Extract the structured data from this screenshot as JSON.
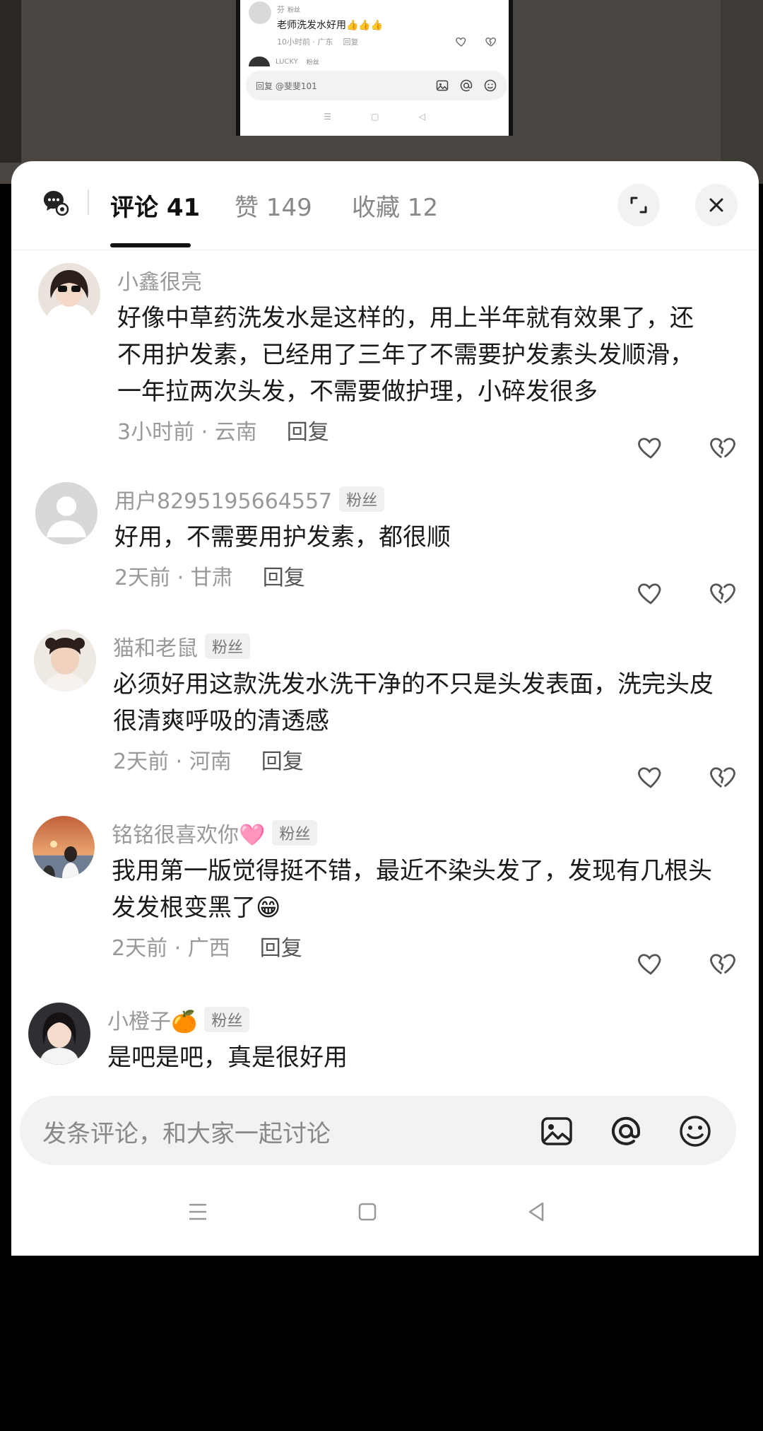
{
  "mini_screen": {
    "comment_name": "芬",
    "comment_tag": "粉丝",
    "comment_text": "老师洗发水好用👍👍👍",
    "comment_time": "10小时前 · 广东",
    "comment_reply": "回复",
    "next_name": "LUCKY",
    "next_tag": "粉丝",
    "input_placeholder": "回复 @斐斐101",
    "nav": [
      "☰",
      "▢",
      "◁"
    ]
  },
  "tabs": {
    "comments": "评论 41",
    "likes": "赞 149",
    "favorites": "收藏 12"
  },
  "comments": [
    {
      "name": "小鑫很亮",
      "badge": "",
      "text": "好像中草药洗发水是这样的，用上半年就有效果了，还不用护发素，已经用了三年了不需要护发素头发顺滑，一年拉两次头发，不需要做护理，小碎发很多",
      "time": "3小时前 · 云南",
      "reply": "回复"
    },
    {
      "name": "用户8295195664557",
      "badge": "粉丝",
      "text": "好用，不需要用护发素，都很顺",
      "time": "2天前 · 甘肃",
      "reply": "回复"
    },
    {
      "name": "猫和老鼠",
      "badge": "粉丝",
      "text": "必须好用这款洗发水洗干净的不只是头发表面，洗完头皮很清爽呼吸的清透感",
      "time": "2天前 · 河南",
      "reply": "回复"
    },
    {
      "name": "铭铭很喜欢你🩷",
      "badge": "粉丝",
      "text": "我用第一版觉得挺不错，最近不染头发了，发现有几根头发发根变黑了😁",
      "time": "2天前 · 广西",
      "reply": "回复"
    },
    {
      "name": "小橙子🍊",
      "badge": "粉丝",
      "text": "是吧是吧，真是很好用",
      "time": "",
      "reply": ""
    }
  ],
  "input": {
    "placeholder": "发条评论，和大家一起讨论"
  },
  "icons": {
    "share": "share-icon",
    "expand": "expand-icon",
    "close": "close-icon",
    "like": "heart-icon",
    "dislike": "broken-heart-icon",
    "image": "image-icon",
    "at": "at-icon",
    "emoji": "emoji-icon"
  }
}
